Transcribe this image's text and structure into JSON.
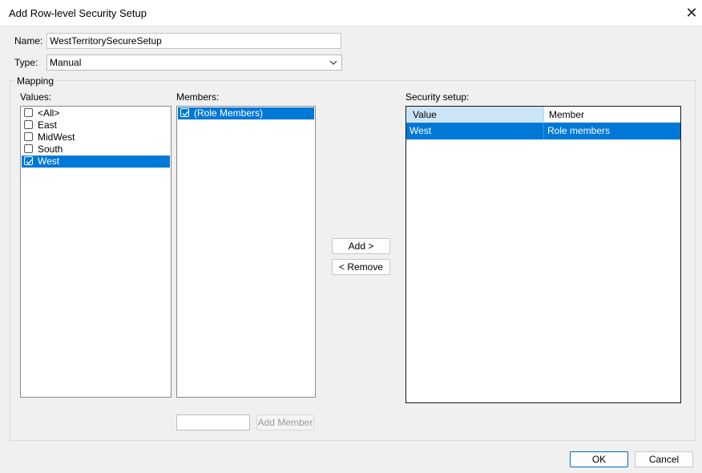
{
  "window": {
    "title": "Add Row-level Security Setup"
  },
  "name_field": {
    "label": "Name:",
    "value": "WestTerritorySecureSetup"
  },
  "type_field": {
    "label": "Type:",
    "value": "Manual"
  },
  "mapping": {
    "label": "Mapping"
  },
  "values": {
    "label": "Values:",
    "items": [
      {
        "label": "<All>",
        "checked": false,
        "selected": false
      },
      {
        "label": "East",
        "checked": false,
        "selected": false
      },
      {
        "label": "MidWest",
        "checked": false,
        "selected": false
      },
      {
        "label": "South",
        "checked": false,
        "selected": false
      },
      {
        "label": "West",
        "checked": true,
        "selected": true
      }
    ]
  },
  "members": {
    "label": "Members:",
    "items": [
      {
        "label": "(Role Members)",
        "checked": true,
        "selected": true
      }
    ],
    "new_member_input": "",
    "add_member_label": "Add Member"
  },
  "actions": {
    "add_label": "Add >",
    "remove_label": "< Remove"
  },
  "security_setup": {
    "label": "Security setup:",
    "columns": [
      "Value",
      "Member"
    ],
    "rows": [
      {
        "value": "West",
        "member": "Role members",
        "selected": true
      }
    ]
  },
  "footer": {
    "ok_label": "OK",
    "cancel_label": "Cancel"
  },
  "colors": {
    "selection": "#0078d7",
    "header_selected": "#cce4f7",
    "primary_border": "#0067c0"
  },
  "icons": {
    "close": "close-icon",
    "dropdown": "chevron-down-icon",
    "check": "checkmark-icon"
  }
}
